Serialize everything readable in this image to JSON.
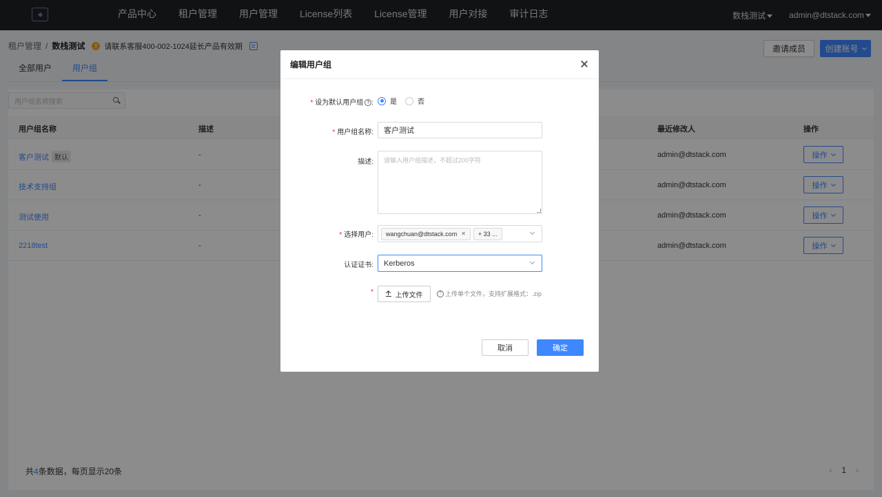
{
  "topbar": {
    "nav": [
      "产品中心",
      "租户管理",
      "用户管理",
      "License列表",
      "License管理",
      "用户对接",
      "审计日志"
    ],
    "tenant": "数栈测试",
    "user": "admin@dtstack.com"
  },
  "header": {
    "crumb_parent": "租户管理",
    "crumb_sep": "/",
    "crumb_current": "数栈测试",
    "notice": "请联系客服400-002-1024延长产品有效期",
    "invite_label": "邀请成员",
    "create_label": "创建账号"
  },
  "tabs": [
    "全部用户",
    "用户组"
  ],
  "search": {
    "placeholder": "用户组名称搜索"
  },
  "table": {
    "columns": [
      "用户组名称",
      "描述",
      "最近修改人",
      "操作"
    ],
    "rows": [
      {
        "name": "客户测试",
        "badge": "默认",
        "desc": "-",
        "modifier": "admin@dtstack.com",
        "op": "操作"
      },
      {
        "name": "技术支持组",
        "badge": "",
        "desc": "-",
        "modifier": "admin@dtstack.com",
        "op": "操作"
      },
      {
        "name": "测试使用",
        "badge": "",
        "desc": "-",
        "modifier": "admin@dtstack.com",
        "op": "操作"
      },
      {
        "name": "2218test",
        "badge": "",
        "desc": "-",
        "modifier": "admin@dtstack.com",
        "op": "操作"
      }
    ]
  },
  "footer": {
    "prefix": "共",
    "count": "4",
    "suffix": "条数据，每页显示20条",
    "page": "1"
  },
  "modal": {
    "title": "编辑用户组",
    "default_label": "设为默认用户组",
    "yes": "是",
    "no": "否",
    "name_label": "用户组名称",
    "name_value": "客户测试",
    "desc_label": "描述",
    "desc_placeholder": "请输入用户组描述，不超过200字符",
    "users_label": "选择用户",
    "user_tag": "wangchuan@dtstack.com",
    "more_tag": "+ 33 ...",
    "cert_label": "认证证书",
    "cert_value": "Kerberos",
    "upload_label": "上传文件",
    "upload_hint": "上传单个文件，支持扩展格式：.zip",
    "cancel": "取消",
    "ok": "确定"
  },
  "colors": {
    "accent": "#3f87ff",
    "topbar": "#1f2124",
    "required": "#f5222d"
  }
}
